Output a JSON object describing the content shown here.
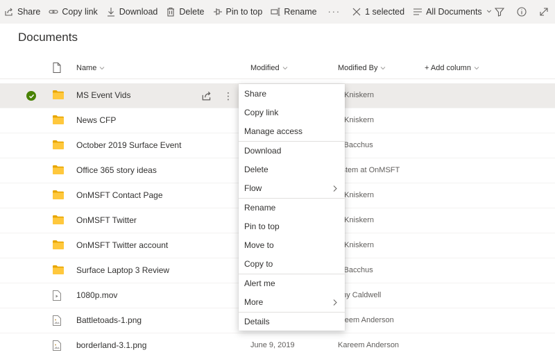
{
  "command_bar": {
    "share": "Share",
    "copy_link": "Copy link",
    "download": "Download",
    "delete": "Delete",
    "pin_to_top": "Pin to top",
    "rename": "Rename",
    "more": "···",
    "selected": "1 selected",
    "view": "All Documents"
  },
  "page": {
    "title": "Documents"
  },
  "columns": {
    "name": "Name",
    "modified": "Modified",
    "modified_by": "Modified By",
    "add_column": "+ Add column"
  },
  "rows": [
    {
      "name": "MS Event Vids",
      "modified": "",
      "modified_by": "o Kniskern",
      "type": "folder"
    },
    {
      "name": "News CFP",
      "modified": "",
      "modified_by": "o Kniskern",
      "type": "folder"
    },
    {
      "name": "October 2019 Surface Event",
      "modified": "",
      "modified_by": "if Bacchus",
      "type": "folder"
    },
    {
      "name": "Office 365 story ideas",
      "modified": "",
      "modified_by": "ystem at OnMSFT",
      "type": "folder"
    },
    {
      "name": "OnMSFT Contact Page",
      "modified": "",
      "modified_by": "o Kniskern",
      "type": "folder"
    },
    {
      "name": "OnMSFT Twitter",
      "modified": "",
      "modified_by": "o Kniskern",
      "type": "folder"
    },
    {
      "name": "OnMSFT Twitter account",
      "modified": "",
      "modified_by": "o Kniskern",
      "type": "folder"
    },
    {
      "name": "Surface Laptop 3 Review",
      "modified": "",
      "modified_by": "if Bacchus",
      "type": "folder"
    },
    {
      "name": "1080p.mov",
      "modified": "",
      "modified_by": "nny Caldwell",
      "type": "video"
    },
    {
      "name": "Battletoads-1.png",
      "modified": "",
      "modified_by": "areem Anderson",
      "type": "image"
    },
    {
      "name": "borderland-3.1.png",
      "modified": "June 9, 2019",
      "modified_by": "Kareem Anderson",
      "type": "image"
    }
  ],
  "context_menu": {
    "share": "Share",
    "copy_link": "Copy link",
    "manage_access": "Manage access",
    "download": "Download",
    "delete": "Delete",
    "flow": "Flow",
    "rename": "Rename",
    "pin_to_top": "Pin to top",
    "move_to": "Move to",
    "copy_to": "Copy to",
    "alert_me": "Alert me",
    "more": "More",
    "details": "Details"
  },
  "colors": {
    "folder": "#ffb900",
    "check": "#498205",
    "command_bar_bg": "#f3f2f1",
    "selected_row_bg": "#edebe9"
  }
}
